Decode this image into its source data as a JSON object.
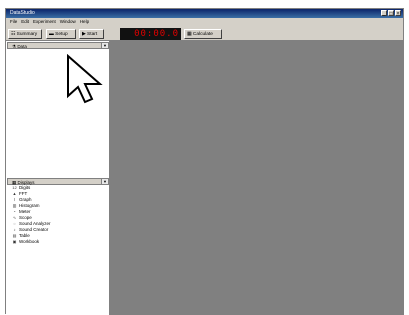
{
  "window": {
    "title": "DataStudio"
  },
  "menu": [
    {
      "label": "File"
    },
    {
      "label": "Edit"
    },
    {
      "label": "Experiment"
    },
    {
      "label": "Window"
    },
    {
      "label": "Help"
    }
  ],
  "toolbar": {
    "summary_label": "Summary",
    "setup_label": "Setup",
    "start_label": "Start",
    "timer_value": "00:00.0",
    "calculate_label": "Calculate"
  },
  "data_panel": {
    "header": "Data"
  },
  "displays_panel": {
    "header": "Displays",
    "items": [
      {
        "label": "Digits",
        "icon": "digits-icon"
      },
      {
        "label": "FFT",
        "icon": "fft-icon"
      },
      {
        "label": "Graph",
        "icon": "graph-icon"
      },
      {
        "label": "Histogram",
        "icon": "histogram-icon"
      },
      {
        "label": "Meter",
        "icon": "meter-icon"
      },
      {
        "label": "Scope",
        "icon": "scope-icon"
      },
      {
        "label": "Sound Analyzer",
        "icon": "sound-analyzer-icon"
      },
      {
        "label": "Sound Creator",
        "icon": "sound-creator-icon"
      },
      {
        "label": "Table",
        "icon": "table-icon"
      },
      {
        "label": "Workbook",
        "icon": "workbook-icon"
      }
    ]
  },
  "colors": {
    "timer_digits": "#e00000",
    "workspace": "#808080",
    "chrome": "#d4d0c8"
  }
}
